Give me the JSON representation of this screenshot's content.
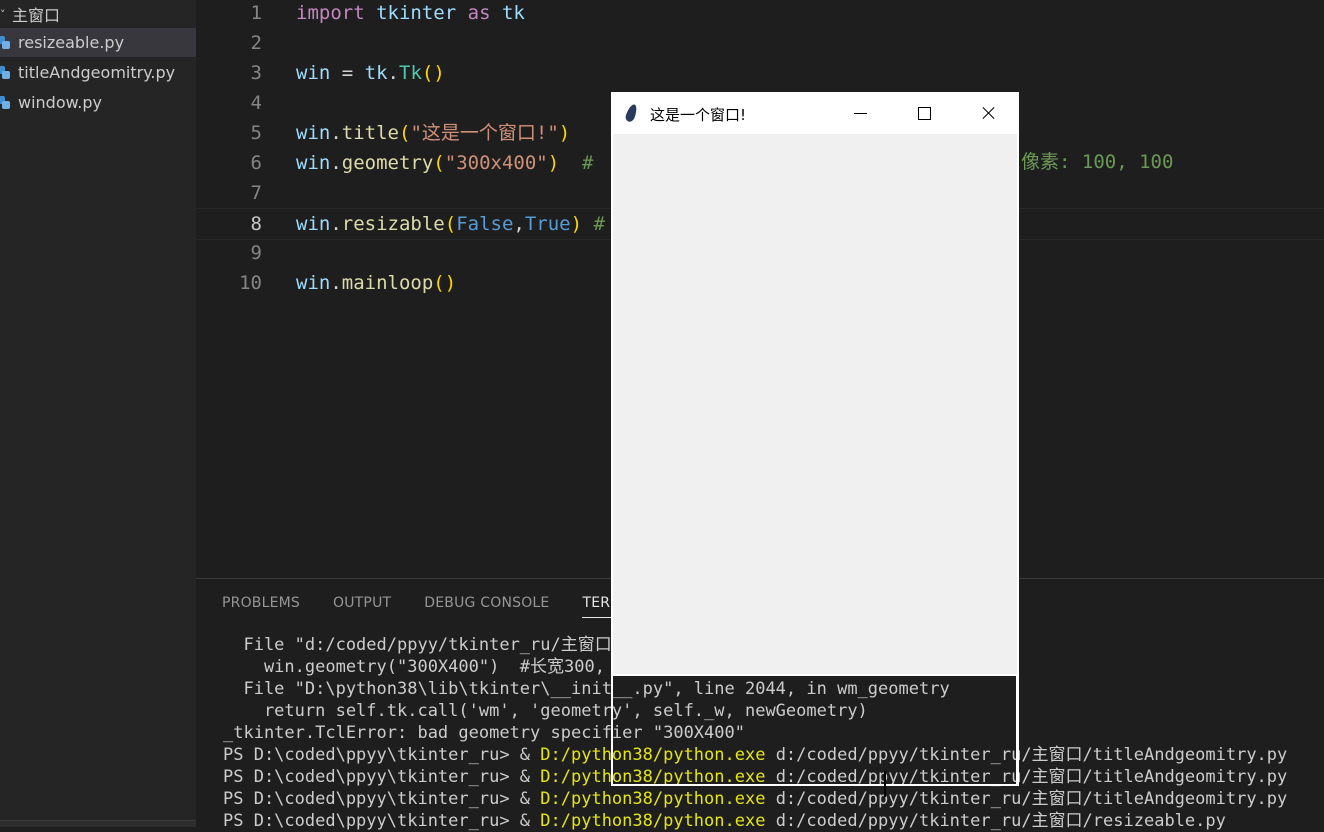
{
  "explorer": {
    "folder": "主窗口",
    "files": [
      "resizeable.py",
      "titleAndgeomitry.py",
      "window.py"
    ]
  },
  "editor": {
    "line_numbers": [
      "1",
      "2",
      "3",
      "4",
      "5",
      "6",
      "7",
      "8",
      "9",
      "10"
    ],
    "lines": [
      {
        "n": "1",
        "tokens": [
          [
            "kw",
            "import"
          ],
          [
            "txt",
            " "
          ],
          [
            "var",
            "tkinter"
          ],
          [
            "txt",
            " "
          ],
          [
            "kw",
            "as"
          ],
          [
            "txt",
            " "
          ],
          [
            "var",
            "tk"
          ]
        ]
      },
      {
        "n": "2",
        "tokens": []
      },
      {
        "n": "3",
        "tokens": [
          [
            "var",
            "win"
          ],
          [
            "txt",
            " = "
          ],
          [
            "var",
            "tk"
          ],
          [
            "txt",
            "."
          ],
          [
            "cls",
            "Tk"
          ],
          [
            "pn",
            "()"
          ]
        ]
      },
      {
        "n": "4",
        "tokens": []
      },
      {
        "n": "5",
        "tokens": [
          [
            "var",
            "win"
          ],
          [
            "txt",
            "."
          ],
          [
            "fn",
            "title"
          ],
          [
            "pn",
            "("
          ],
          [
            "str",
            "\"这是一个窗口!\""
          ],
          [
            "pn",
            ")"
          ]
        ]
      },
      {
        "n": "6",
        "tokens": [
          [
            "var",
            "win"
          ],
          [
            "txt",
            "."
          ],
          [
            "fn",
            "geometry"
          ],
          [
            "pn",
            "("
          ],
          [
            "str",
            "\"300x400\""
          ],
          [
            "pn",
            ")"
          ],
          [
            "txt",
            "  "
          ],
          [
            "cm",
            "#"
          ]
        ]
      },
      {
        "n": "7",
        "tokens": []
      },
      {
        "n": "8",
        "tokens": [
          [
            "var",
            "win"
          ],
          [
            "txt",
            "."
          ],
          [
            "fn",
            "resizable"
          ],
          [
            "pn",
            "("
          ],
          [
            "bool",
            "False"
          ],
          [
            "txt",
            ","
          ],
          [
            "bool",
            "True"
          ],
          [
            "pn",
            ")"
          ],
          [
            "txt",
            " "
          ],
          [
            "cm",
            "#"
          ]
        ]
      },
      {
        "n": "9",
        "tokens": []
      },
      {
        "n": "10",
        "tokens": [
          [
            "var",
            "win"
          ],
          [
            "txt",
            "."
          ],
          [
            "fn",
            "mainloop"
          ],
          [
            "pn",
            "()"
          ]
        ]
      }
    ],
    "comment_tail": "像素: 100, 100"
  },
  "panel": {
    "tabs": [
      "PROBLEMS",
      "OUTPUT",
      "DEBUG CONSOLE",
      "TERMINAL"
    ],
    "active_tab": "TERMINAL",
    "terminal": [
      {
        "plain": "  File \"d:/coded/ppyy/tkinter_ru/主窗口/"
      },
      {
        "plain": "    win.geometry(\"300X400\")  #长宽300, 4"
      },
      {
        "plain": "  File \"D:\\python38\\lib\\tkinter\\__init__.py\", line 2044, in wm_geometry"
      },
      {
        "plain": "    return self.tk.call('wm', 'geometry', self._w, newGeometry)"
      },
      {
        "plain": "_tkinter.TclError: bad geometry specifier \"300X400\""
      },
      {
        "prompt": "PS D:\\coded\\ppyy\\tkinter_ru> & ",
        "exe": "D:/python38/python.exe",
        "arg": " d:/coded/ppyy/tkinter_ru/主窗口/titleAndgeomitry.py"
      },
      {
        "prompt": "PS D:\\coded\\ppyy\\tkinter_ru> & ",
        "exe": "D:/python38/python.exe",
        "arg": " d:/coded/ppyy/tkinter_ru/主窗口/titleAndgeomitry.py"
      },
      {
        "prompt": "PS D:\\coded\\ppyy\\tkinter_ru> & ",
        "exe": "D:/python38/python.exe",
        "arg": " d:/coded/ppyy/tkinter_ru/主窗口/titleAndgeomitry.py"
      },
      {
        "prompt": "PS D:\\coded\\ppyy\\tkinter_ru> & ",
        "exe": "D:/python38/python.exe",
        "arg": " d:/coded/ppyy/tkinter_ru/主窗口/resizeable.py"
      }
    ]
  },
  "tk_window": {
    "title": "这是一个窗口!",
    "icon": "feather-icon"
  }
}
